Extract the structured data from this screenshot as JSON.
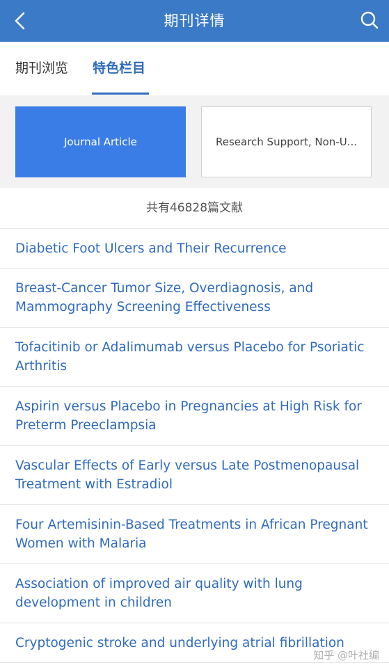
{
  "header": {
    "title": "期刊详情",
    "back_icon": "chevron-left-icon",
    "search_icon": "search-icon",
    "background": "#3b7ac6"
  },
  "tabs": [
    {
      "label": "期刊浏览",
      "active": false
    },
    {
      "label": "特色栏目",
      "active": true
    }
  ],
  "categories": [
    {
      "label": "Journal Article",
      "selected": true
    },
    {
      "label": "Research Support, Non-U...",
      "selected": false
    }
  ],
  "count_text": "共有46828篇文献",
  "articles": [
    "Diabetic Foot Ulcers and Their Recurrence",
    "Breast-Cancer Tumor Size, Overdiagnosis, and Mammography Screening Effectiveness",
    "Tofacitinib or Adalimumab versus Placebo for Psoriatic Arthritis",
    "Aspirin versus Placebo in Pregnancies at High Risk for Preterm Preeclampsia",
    "Vascular Effects of Early versus Late Postmenopausal Treatment with Estradiol",
    "Four Artemisinin-Based Treatments in African Pregnant Women with Malaria",
    "Association of improved air quality with lung development in children",
    "Cryptogenic stroke and underlying atrial fibrillation"
  ],
  "watermark": "知乎 @叶社编",
  "colors": {
    "accent": "#2f6bbf",
    "selected_category": "#3b7de6"
  }
}
